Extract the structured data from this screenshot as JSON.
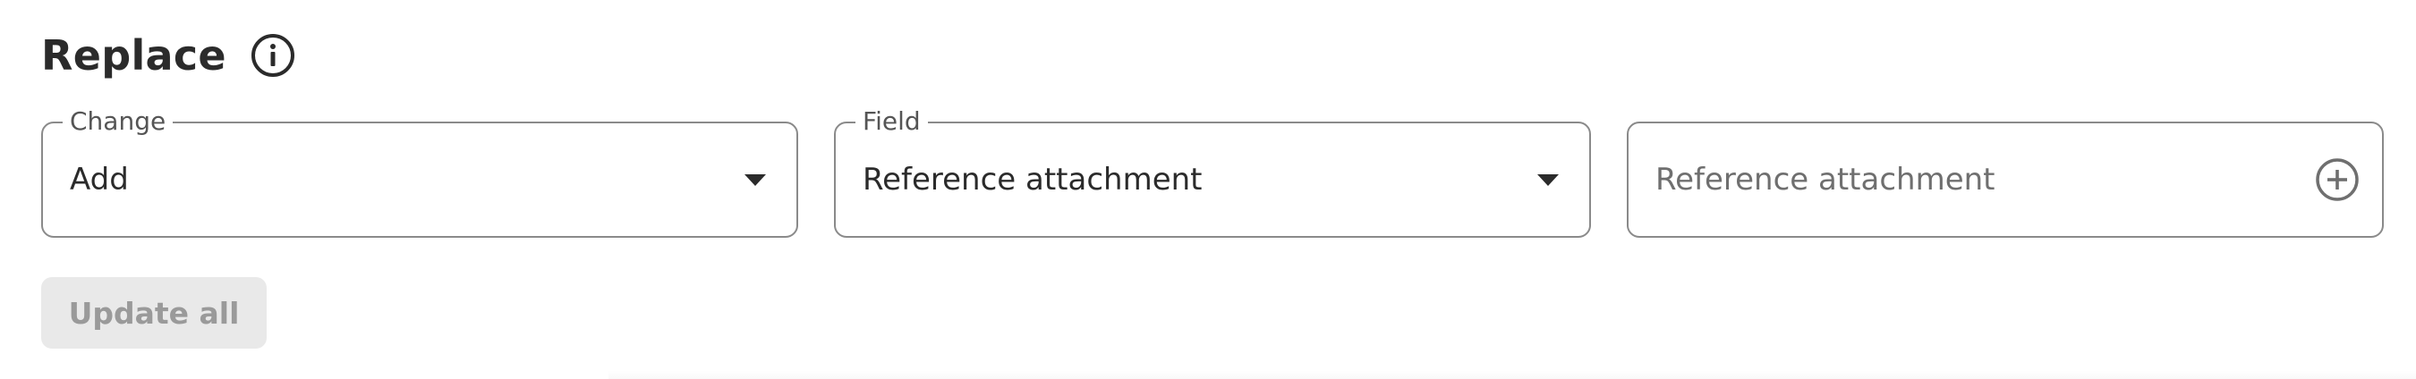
{
  "section": {
    "title": "Replace",
    "info_icon": "info-circle-icon"
  },
  "change_field": {
    "label": "Change",
    "value": "Add",
    "icon": "caret-down-icon"
  },
  "target_field": {
    "label": "Field",
    "value": "Reference attachment",
    "icon": "caret-down-icon"
  },
  "attachment_input": {
    "placeholder": "Reference attachment",
    "icon": "plus-circle-icon"
  },
  "actions": {
    "update_all_label": "Update all"
  },
  "colors": {
    "text": "#2b2b2b",
    "border": "#8a8a8a",
    "button_disabled_bg": "#e9e9e9",
    "button_disabled_text": "#9a9a9a"
  }
}
